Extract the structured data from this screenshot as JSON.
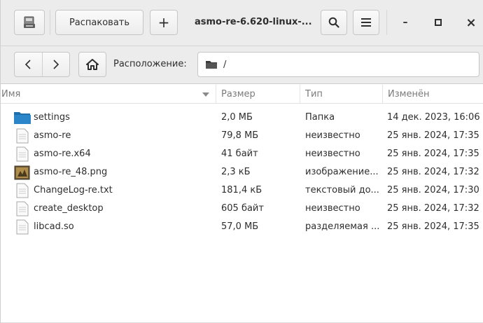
{
  "header": {
    "extract_label": "Распаковать",
    "add_label": "+",
    "title": "asmo-re-6.620-linux-...",
    "minimize_label": "–",
    "maximize_label": "□",
    "close_label": "×"
  },
  "location": {
    "label": "Расположение:",
    "path": "/"
  },
  "columns": {
    "name": "Имя",
    "size": "Размер",
    "type": "Тип",
    "modified": "Изменён"
  },
  "files": [
    {
      "icon": "folder-icon",
      "name": "settings",
      "size": "2,0 МБ",
      "type": "Папка",
      "modified": "14 дек. 2023, 16:06"
    },
    {
      "icon": "file-icon",
      "name": "asmo-re",
      "size": "79,8 МБ",
      "type": "неизвестно",
      "modified": "25 янв. 2024, 17:35"
    },
    {
      "icon": "file-icon",
      "name": "asmo-re.x64",
      "size": "41 байт",
      "type": "неизвестно",
      "modified": "25 янв. 2024, 17:35"
    },
    {
      "icon": "image-icon",
      "name": "asmo-re_48.png",
      "size": "2,3 кБ",
      "type": "изображение...",
      "modified": "25 янв. 2024, 17:32"
    },
    {
      "icon": "file-icon",
      "name": "ChangeLog-re.txt",
      "size": "181,4 кБ",
      "type": "текстовый до...",
      "modified": "25 янв. 2024, 17:30"
    },
    {
      "icon": "file-icon",
      "name": "create_desktop",
      "size": "605 байт",
      "type": "неизвестно",
      "modified": "25 янв. 2024, 17:32"
    },
    {
      "icon": "file-icon",
      "name": "libcad.so",
      "size": "57,0 МБ",
      "type": "разделяемая ...",
      "modified": "25 янв. 2024, 17:35"
    }
  ],
  "colors": {
    "header_bg": "#ececec",
    "folder_blue": "#2a7fc0",
    "text": "#2e2e2e",
    "muted_text": "#7a7a7a"
  }
}
